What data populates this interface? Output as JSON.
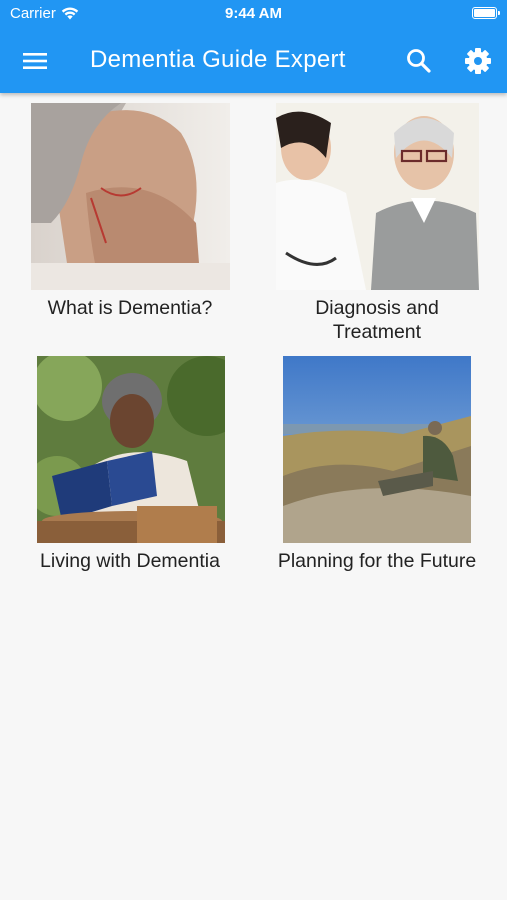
{
  "status_bar": {
    "carrier": "Carrier",
    "time": "9:44 AM"
  },
  "app_bar": {
    "title": "Dementia Guide Expert",
    "background_color": "#2196F3",
    "menu_icon": "hamburger-menu-icon",
    "search_icon": "search-icon",
    "settings_icon": "gear-icon"
  },
  "topics": [
    {
      "label": "What is Dementia?",
      "image": "elderly woman resting face on hand"
    },
    {
      "label": "Diagnosis and\nTreatment",
      "image": "doctor with elderly patient"
    },
    {
      "label": "Living with Dementia",
      "image": "woman reading a book outdoors"
    },
    {
      "label": "Planning for the Future",
      "image": "man resting on rocky mountain top"
    }
  ]
}
